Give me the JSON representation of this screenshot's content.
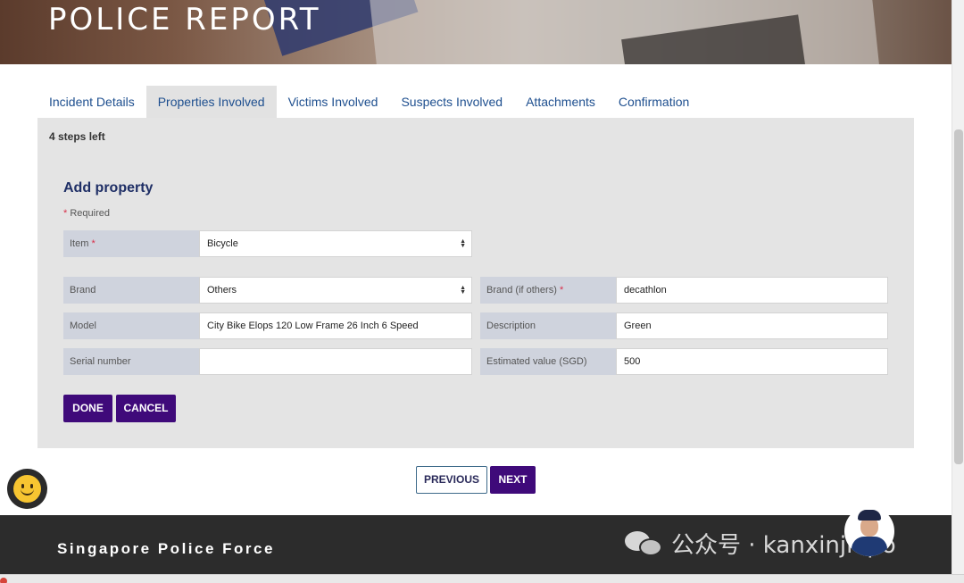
{
  "hero": {
    "title": "POLICE REPORT"
  },
  "tabs": [
    {
      "label": "Incident Details",
      "active": false
    },
    {
      "label": "Properties Involved",
      "active": true
    },
    {
      "label": "Victims Involved",
      "active": false
    },
    {
      "label": "Suspects Involved",
      "active": false
    },
    {
      "label": "Attachments",
      "active": false
    },
    {
      "label": "Confirmation",
      "active": false
    }
  ],
  "panel": {
    "steps_left": "4 steps left",
    "section_title": "Add property",
    "required_note": "Required",
    "required_marker": "*"
  },
  "form": {
    "item": {
      "label": "Item",
      "value": "Bicycle"
    },
    "brand": {
      "label": "Brand",
      "value": "Others"
    },
    "brand_other": {
      "label": "Brand (if others)",
      "value": "decathlon"
    },
    "model": {
      "label": "Model",
      "value": "City Bike Elops 120 Low Frame 26 Inch 6 Speed"
    },
    "description": {
      "label": "Description",
      "value": "Green"
    },
    "serial_number": {
      "label": "Serial number",
      "value": ""
    },
    "estimated_value": {
      "label": "Estimated value (SGD)",
      "value": "500"
    }
  },
  "buttons": {
    "done": "DONE",
    "cancel": "CANCEL",
    "previous": "PREVIOUS",
    "next": "NEXT"
  },
  "footer": {
    "title": "Singapore Police Force",
    "watermark": "公众号 · kanxinjiapo"
  },
  "colors": {
    "primary_button": "#3f0a7a",
    "tab_text": "#1e4f8f",
    "panel_bg": "#e4e4e4",
    "label_bg": "#cfd3dd",
    "footer_bg": "#2c2c2c",
    "required_star": "#d9304a"
  },
  "icons": {
    "select_arrows": "up-down-arrows-icon",
    "chat": "smiley-chat-icon",
    "avatar": "police-officer-avatar",
    "watermark": "wechat-icon"
  }
}
